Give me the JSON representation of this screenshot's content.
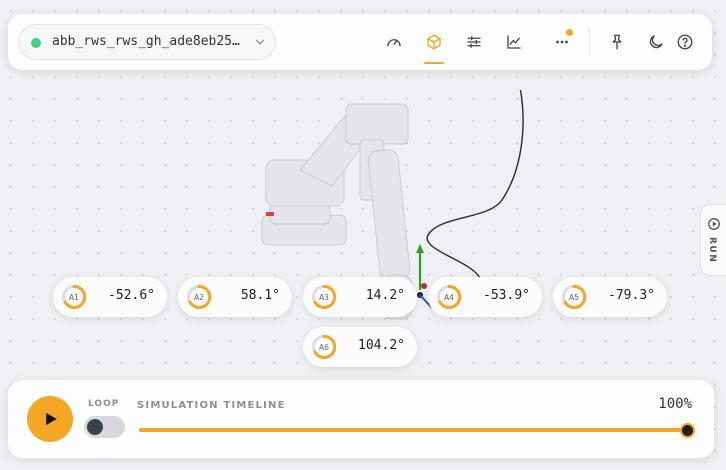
{
  "device": {
    "name": "abb_rws_rws_gh_ade8eb25…",
    "status_color": "#3fd57a"
  },
  "toolbar": {
    "items": [
      {
        "name": "gauge-icon",
        "active": false
      },
      {
        "name": "cube-icon",
        "active": true
      },
      {
        "name": "sliders-icon",
        "active": false
      },
      {
        "name": "chart-icon",
        "active": false
      },
      {
        "name": "more-icon",
        "active": false,
        "notification": true
      },
      {
        "name": "pin-icon",
        "active": false
      },
      {
        "name": "moon-icon",
        "active": false
      },
      {
        "name": "help-icon",
        "active": false
      }
    ]
  },
  "run_tab": {
    "label": "RUN"
  },
  "joints": [
    {
      "label": "A1",
      "value": "-52.6°"
    },
    {
      "label": "A2",
      "value": "58.1°"
    },
    {
      "label": "A3",
      "value": "14.2°"
    },
    {
      "label": "A4",
      "value": "-53.9°"
    },
    {
      "label": "A5",
      "value": "-79.3°"
    },
    {
      "label": "A6",
      "value": "104.2°"
    }
  ],
  "playback": {
    "loop_label": "LOOP",
    "loop_enabled": false,
    "timeline_label": "SIMULATION TIMELINE",
    "progress_text": "100%",
    "progress": 1.0
  },
  "colors": {
    "accent": "#f5a623"
  }
}
